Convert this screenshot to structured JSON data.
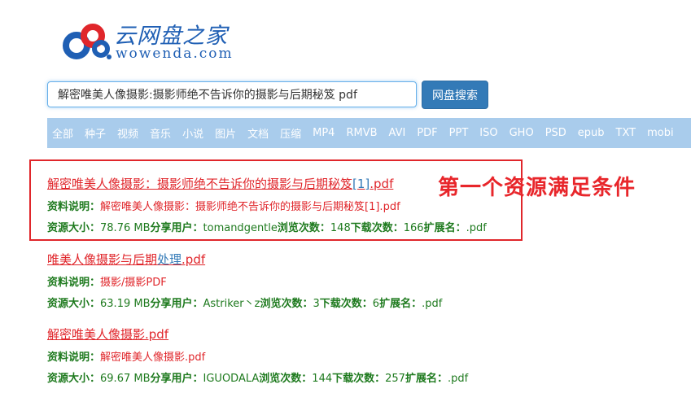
{
  "logo": {
    "cn": "云网盘之家",
    "en": "wowenda.com"
  },
  "search": {
    "value": "解密唯美人像摄影:摄影师绝不告诉你的摄影与后期秘笈 pdf",
    "button_label": "网盘搜索"
  },
  "categories": [
    "全部",
    "种子",
    "视频",
    "音乐",
    "小说",
    "图片",
    "文档",
    "压缩",
    "MP4",
    "RMVB",
    "AVI",
    "PDF",
    "PPT",
    "ISO",
    "GHO",
    "PSD",
    "epub",
    "TXT",
    "mobi"
  ],
  "annotation": "第一个资源满足条件",
  "labels": {
    "desc": "资料说明：",
    "size": "资源大小：",
    "sharer": "分享用户：",
    "views": "浏览次数：",
    "downloads": "下载次数：",
    "ext": "扩展名："
  },
  "results": [
    {
      "title_main": "解密唯美人像摄影：摄影师绝不告诉你的摄影与后期秘笈",
      "title_link": "[1]",
      "title_end": ".pdf",
      "desc": "解密唯美人像摄影：摄影师绝不告诉你的摄影与后期秘笈[1].pdf",
      "size": "78.76 MB",
      "sharer": "tomandgentle",
      "views": "148",
      "downloads": "166",
      "ext": ".pdf"
    },
    {
      "title_main": "唯美人像摄影与后期",
      "title_link": "处理",
      "title_end": ".pdf",
      "desc": "摄影/摄影PDF",
      "size": "63.19 MB",
      "sharer": "Astriker丶z",
      "views": "3",
      "downloads": "6",
      "ext": ".pdf"
    },
    {
      "title_main": "解密唯美人像摄影.pdf",
      "title_link": "",
      "title_end": "",
      "desc": "解密唯美人像摄影.pdf",
      "size": "69.67 MB",
      "sharer": "IGUODALA",
      "views": "144",
      "downloads": "257",
      "ext": ".pdf"
    }
  ]
}
